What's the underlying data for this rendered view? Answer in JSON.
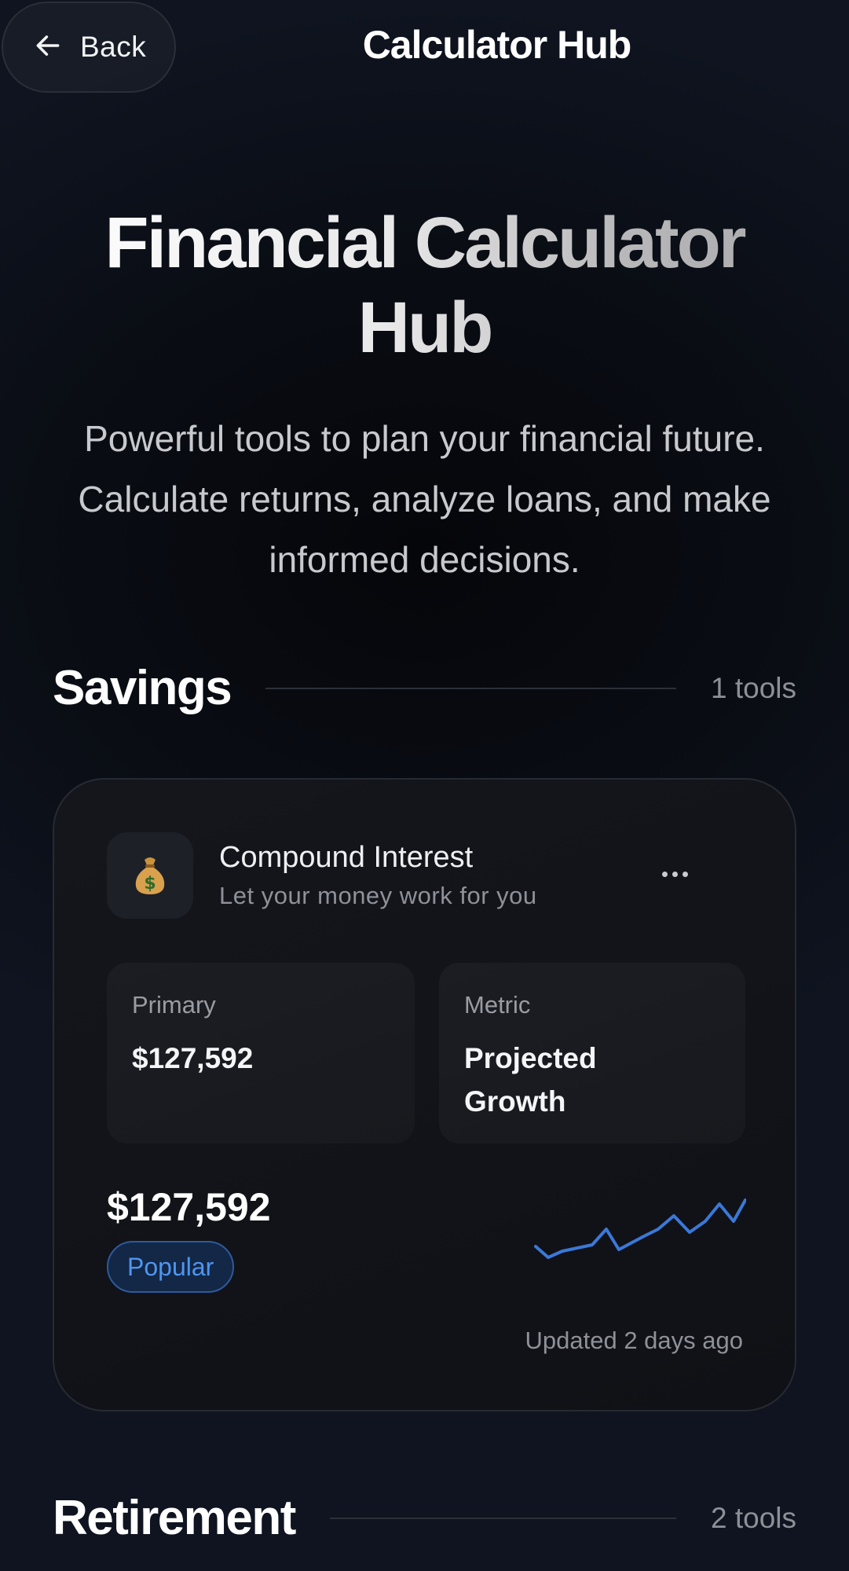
{
  "header": {
    "back_label": "Back",
    "title": "Calculator Hub"
  },
  "hero": {
    "title": "Financial Calculator Hub",
    "subtitle": "Powerful tools to plan your financial future. Calculate returns, analyze loans, and make informed decisions."
  },
  "sections": [
    {
      "title": "Savings",
      "count": "1 tools",
      "tools": [
        {
          "icon": "money-bag-icon",
          "emoji": "💰",
          "name": "Compound Interest",
          "description": "Let your money work for you",
          "stats": [
            {
              "label": "Primary",
              "value": "$127,592"
            },
            {
              "label": "Metric",
              "value": "Projected Growth"
            }
          ],
          "headline_value": "$127,592",
          "badge": "Popular",
          "updated": "Updated 2 days ago",
          "sparkline_color": "#3b78d8"
        }
      ]
    },
    {
      "title": "Retirement",
      "count": "2 tools"
    }
  ],
  "colors": {
    "background": "#080a10",
    "accent": "#4f95f0",
    "badge_bg": "#132746"
  }
}
